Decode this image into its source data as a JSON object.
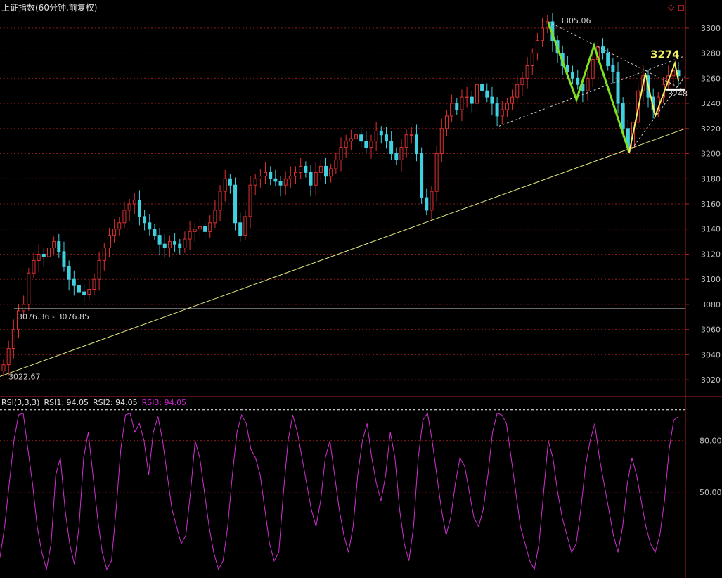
{
  "header": {
    "title": "上证指数(60分钟.前复权)",
    "diamond_icon": "diamond-icon",
    "window_icon": "window-restore-icon"
  },
  "rsi_header": {
    "label": "RSI(3,3,3)",
    "rsi1": "RSI1: 94.05",
    "rsi2": "RSI2: 94.05",
    "rsi3": "RSI3: 94.05",
    "colors": {
      "label": "#e0e0e0",
      "rsi1": "#e0e0e0",
      "rsi2": "#e0e0e0",
      "rsi3": "#d020d0"
    }
  },
  "colors": {
    "up": "#e03030",
    "down": "#40d0e0",
    "axis": "#b02020",
    "grid": "#8a1a1a",
    "trendline": "#e8e880",
    "green_zigzag": "#80e020",
    "yellow_zigzag": "#f0f060",
    "rsi_line": "#d030d0",
    "dashed": "#d0d0d0"
  },
  "chart_data": [
    {
      "type": "candlestick",
      "ylim": [
        3010,
        3310
      ],
      "y_ticks": [
        "3300",
        "3280",
        "3260",
        "3240",
        "3220",
        "3200",
        "3180",
        "3160",
        "3140",
        "3120",
        "3100",
        "3080",
        "3060",
        "3040",
        "3020"
      ],
      "annotations": {
        "high_label": "3305.06",
        "low_label": "3022.67",
        "gap_label": "3076.36 - 3076.85",
        "target_label": "3274",
        "right_label": "3248"
      },
      "close_path": [
        3032,
        3045,
        3060,
        3075,
        3080,
        3105,
        3115,
        3120,
        3118,
        3125,
        3130,
        3122,
        3110,
        3100,
        3095,
        3090,
        3088,
        3092,
        3100,
        3115,
        3125,
        3135,
        3140,
        3145,
        3155,
        3160,
        3163,
        3150,
        3145,
        3140,
        3135,
        3128,
        3125,
        3130,
        3128,
        3125,
        3132,
        3138,
        3140,
        3142,
        3138,
        3145,
        3155,
        3170,
        3180,
        3175,
        3145,
        3135,
        3150,
        3175,
        3180,
        3182,
        3185,
        3180,
        3178,
        3175,
        3180,
        3182,
        3185,
        3190,
        3185,
        3175,
        3185,
        3190,
        3182,
        3188,
        3195,
        3205,
        3210,
        3212,
        3215,
        3210,
        3205,
        3210,
        3218,
        3215,
        3210,
        3200,
        3195,
        3205,
        3215,
        3215,
        3200,
        3165,
        3155,
        3170,
        3200,
        3220,
        3230,
        3240,
        3235,
        3245,
        3245,
        3240,
        3255,
        3250,
        3245,
        3240,
        3230,
        3235,
        3240,
        3245,
        3255,
        3260,
        3270,
        3280,
        3290,
        3300,
        3305,
        3290,
        3280,
        3270,
        3265,
        3260,
        3255,
        3250,
        3260,
        3275,
        3285,
        3280,
        3270,
        3265,
        3240,
        3220,
        3205,
        3225,
        3250,
        3262,
        3245,
        3235,
        3245,
        3255,
        3262,
        3266,
        3262
      ],
      "volume_hidden": true
    },
    {
      "type": "line",
      "name": "RSI",
      "ylim": [
        0,
        100
      ],
      "y_ticks": [
        "80.00",
        "50.00"
      ],
      "values": [
        12,
        30,
        55,
        80,
        95,
        96,
        75,
        55,
        30,
        15,
        5,
        20,
        60,
        70,
        40,
        20,
        8,
        30,
        70,
        85,
        60,
        35,
        15,
        5,
        10,
        40,
        75,
        95,
        96,
        85,
        90,
        80,
        60,
        85,
        94,
        80,
        60,
        40,
        30,
        20,
        25,
        50,
        80,
        70,
        50,
        30,
        15,
        5,
        10,
        30,
        60,
        85,
        95,
        90,
        75,
        70,
        60,
        40,
        20,
        10,
        15,
        50,
        80,
        95,
        85,
        70,
        55,
        40,
        30,
        45,
        70,
        80,
        60,
        40,
        25,
        15,
        30,
        60,
        80,
        90,
        70,
        55,
        45,
        60,
        85,
        70,
        40,
        20,
        10,
        30,
        70,
        92,
        96,
        80,
        60,
        40,
        25,
        35,
        55,
        70,
        65,
        50,
        35,
        30,
        40,
        60,
        85,
        96,
        95,
        90,
        70,
        50,
        30,
        20,
        10,
        5,
        20,
        50,
        80,
        70,
        50,
        35,
        25,
        15,
        20,
        40,
        65,
        80,
        90,
        70,
        55,
        40,
        25,
        15,
        30,
        55,
        70,
        60,
        45,
        30,
        20,
        15,
        25,
        45,
        75,
        92,
        94
      ]
    }
  ]
}
